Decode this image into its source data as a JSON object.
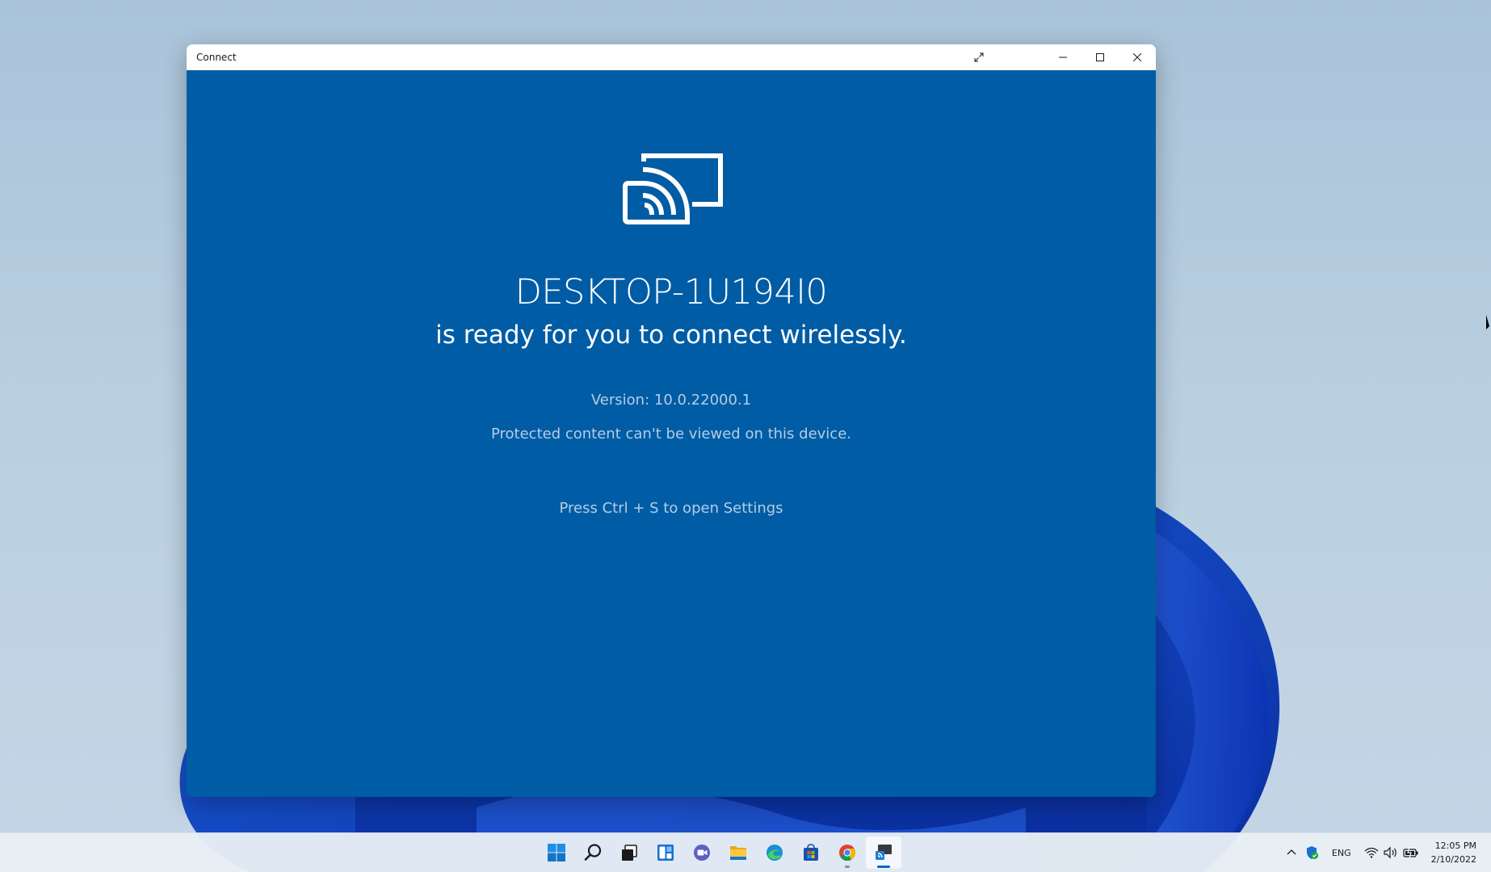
{
  "window": {
    "title": "Connect",
    "controls": {
      "fullscreen_icon": "expand-diagonal-icon",
      "minimize_icon": "minimize-icon",
      "maximize_icon": "maximize-icon",
      "close_icon": "close-icon"
    }
  },
  "content": {
    "hero_icon": "wireless-display-cast-icon",
    "device_name": "DESKTOP-1U194I0",
    "ready_message": "is ready for you to connect wirelessly.",
    "version": "Version: 10.0.22000.1",
    "protected_notice": "Protected content can't be viewed on this device.",
    "settings_hint": "Press Ctrl + S to open Settings",
    "background_color": "#005ca5"
  },
  "taskbar": {
    "apps": [
      {
        "name": "Start",
        "icon": "windows-start-icon"
      },
      {
        "name": "Search",
        "icon": "search-icon"
      },
      {
        "name": "Task View",
        "icon": "task-view-icon"
      },
      {
        "name": "Widgets",
        "icon": "widgets-icon"
      },
      {
        "name": "Chat",
        "icon": "chat-icon"
      },
      {
        "name": "File Explorer",
        "icon": "folder-icon"
      },
      {
        "name": "Microsoft Edge",
        "icon": "edge-icon"
      },
      {
        "name": "Microsoft Store",
        "icon": "store-icon"
      },
      {
        "name": "Google Chrome",
        "icon": "chrome-icon"
      },
      {
        "name": "Connect",
        "icon": "connect-icon",
        "active": true
      }
    ],
    "tray": {
      "chevron_icon": "chevron-up-icon",
      "security_icon": "windows-security-icon",
      "language": "ENG",
      "wifi_icon": "wifi-icon",
      "volume_icon": "volume-icon",
      "battery_icon": "battery-icon",
      "time": "12:05 PM",
      "date": "2/10/2022"
    }
  }
}
